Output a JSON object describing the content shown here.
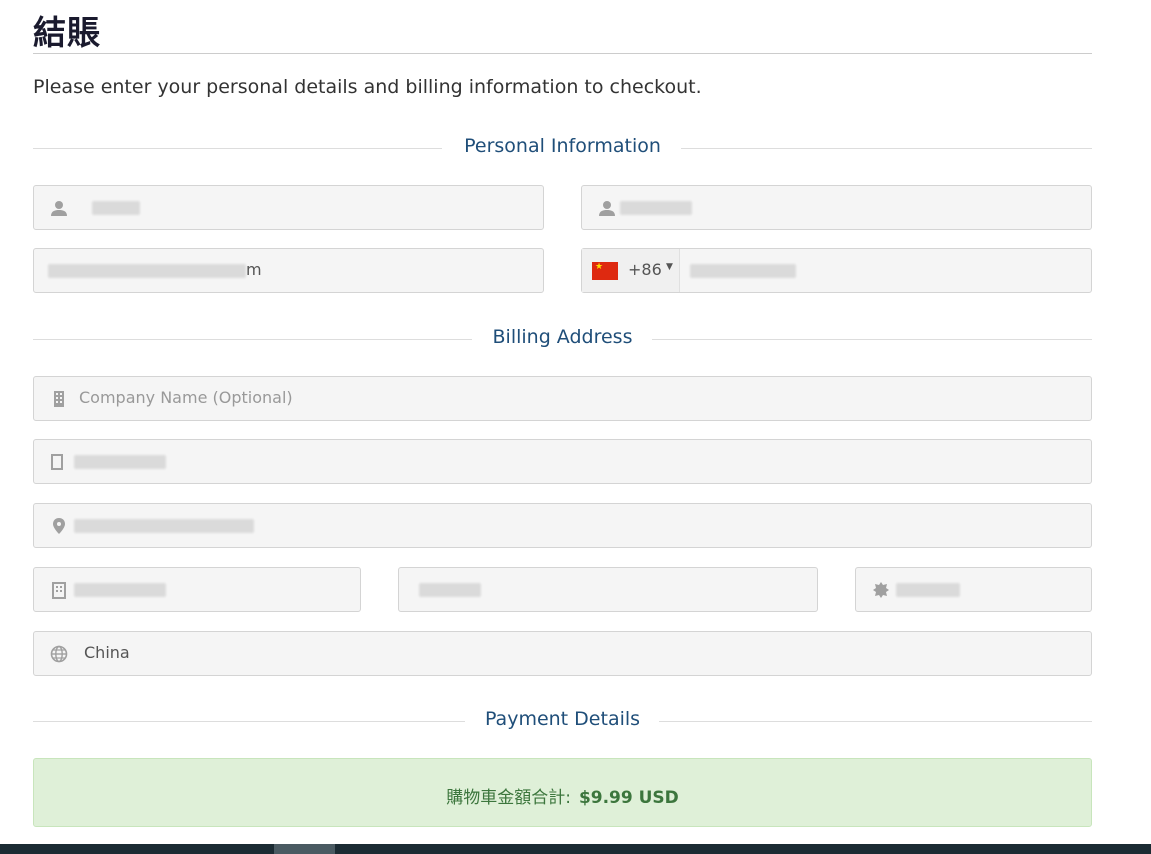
{
  "page": {
    "title": "結賬",
    "intro": "Please enter your personal details and billing information to checkout."
  },
  "sections": {
    "personal": "Personal Information",
    "billing": "Billing Address",
    "payment": "Payment Details"
  },
  "personal": {
    "first_name_icon": "user-icon",
    "last_name_icon": "user-icon",
    "email_value_tail": "m",
    "phone_country": "China",
    "phone_dial_code": "+86"
  },
  "billing": {
    "company_placeholder": "Company Name (Optional)",
    "country_value": "China",
    "icons": [
      "building-icon",
      "address-card-icon",
      "map-marker-icon",
      "city-icon",
      "certificate-icon",
      "globe-icon"
    ]
  },
  "payment": {
    "cart_total_label": "購物車金額合計:",
    "cart_total_amount": "$9.99 USD"
  },
  "colors": {
    "section_heading": "#1f4e79",
    "success_bg": "#dff0d8",
    "success_text": "#3c763d",
    "input_bg": "#f5f5f5",
    "footer": "#1b2b33"
  }
}
